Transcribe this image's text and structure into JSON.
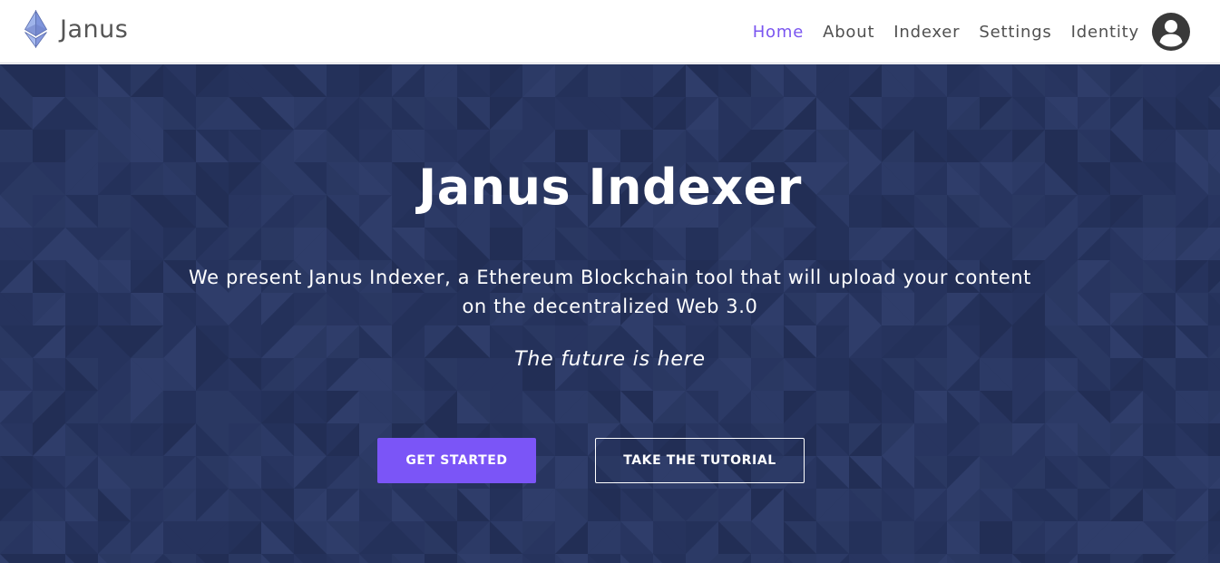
{
  "brand": {
    "name": "Janus",
    "logo_icon": "ethereum-diamond-icon"
  },
  "nav": {
    "items": [
      {
        "label": "Home",
        "active": true
      },
      {
        "label": "About",
        "active": false
      },
      {
        "label": "Indexer",
        "active": false
      },
      {
        "label": "Settings",
        "active": false
      },
      {
        "label": "Identity",
        "active": false
      }
    ],
    "profile_icon": "user-circle-icon"
  },
  "hero": {
    "title": "Janus Indexer",
    "description": "We present Janus Indexer, a Ethereum Blockchain tool that will upload your content on the decentralized Web 3.0",
    "tagline": "The future is here",
    "primary_button": "GET STARTED",
    "secondary_button": "TAKE THE TUTORIAL"
  },
  "colors": {
    "accent": "#7b55f7",
    "nav_active": "#7a55f0",
    "hero_background": "#27345c",
    "nav_text": "#505050"
  }
}
